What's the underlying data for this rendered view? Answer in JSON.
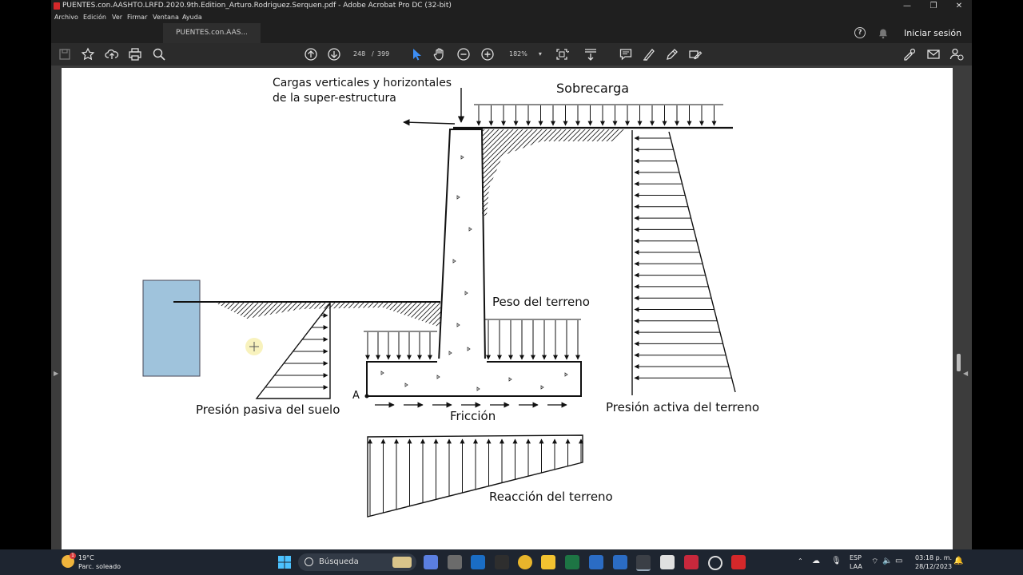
{
  "window": {
    "title": "PUENTES.con.AASHTO.LRFD.2020.9th.Edition_Arturo.Rodriguez.Serquen.pdf - Adobe Acrobat Pro DC (32-bit)",
    "minimize": "—",
    "maximize": "❐",
    "close": "✕"
  },
  "menu": {
    "items": [
      "Archivo",
      "Edición",
      "Ver",
      "Firmar",
      "Ventana",
      "Ayuda"
    ]
  },
  "tabs": {
    "active_label": "PUENTES.con.AAS...",
    "help_label": "?",
    "signin_label": "Iniciar sesión"
  },
  "toolbar": {
    "current_page": "248",
    "page_separator": "/",
    "total_pages": "399",
    "zoom": "182%",
    "zoom_caret": "▾"
  },
  "document": {
    "labels": {
      "top_loads_line1": "Cargas verticales y horizontales",
      "top_loads_line2": "de la super-estructura",
      "surcharge": "Sobrecarga",
      "soil_weight": "Peso del terreno",
      "passive_pressure": "Presión pasiva del suelo",
      "active_pressure": "Presión activa del terreno",
      "point_a": "A",
      "friction": "Fricción",
      "soil_reaction": "Reacción del terreno"
    },
    "overlay_color": "#9fc3dc"
  },
  "side_toggles": {
    "left": "▶",
    "right": "◀"
  },
  "taskbar": {
    "weather_temp": "19°C",
    "weather_desc": "Parc. soleado",
    "weather_badge": "1",
    "search_placeholder": "Búsqueda",
    "lang_line1": "ESP",
    "lang_line2": "LAA",
    "time": "03:18 p. m.",
    "date": "28/12/2023"
  }
}
